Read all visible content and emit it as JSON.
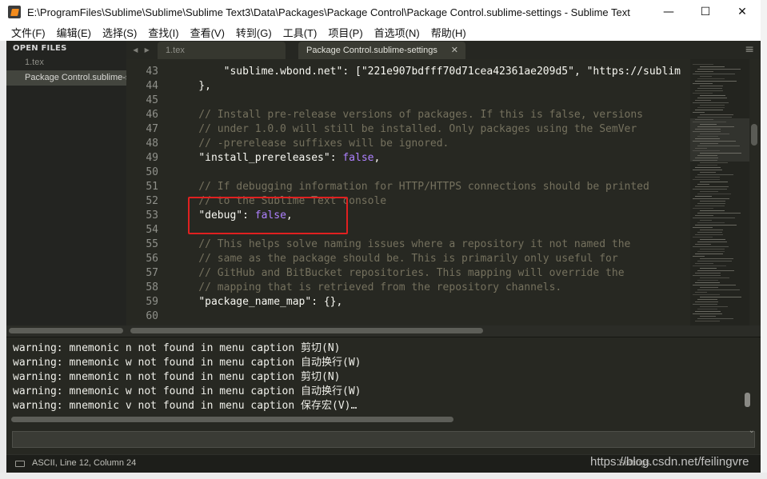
{
  "window": {
    "title": "E:\\ProgramFiles\\Sublime\\Sublime\\Sublime Text3\\Data\\Packages\\Package Control\\Package Control.sublime-settings - Sublime Text",
    "minimize_glyph": "—",
    "maximize_glyph": "☐",
    "close_glyph": "✕"
  },
  "menu": [
    {
      "label": "文件(F)"
    },
    {
      "label": "编辑(E)"
    },
    {
      "label": "选择(S)"
    },
    {
      "label": "查找(I)"
    },
    {
      "label": "查看(V)"
    },
    {
      "label": "转到(G)"
    },
    {
      "label": "工具(T)"
    },
    {
      "label": "项目(P)"
    },
    {
      "label": "首选项(N)"
    },
    {
      "label": "帮助(H)"
    }
  ],
  "sidebar": {
    "header": "OPEN FILES",
    "files": [
      {
        "label": "1.tex",
        "active": false
      },
      {
        "label": "Package Control.sublime-settings",
        "active": true
      }
    ]
  },
  "tabs": {
    "nav_left": "◀",
    "nav_right": "▶",
    "items": [
      {
        "label": "1.tex",
        "active": false
      },
      {
        "label": "Package Control.sublime-settings",
        "active": true,
        "close": "✕"
      }
    ],
    "menu_icon": "≡"
  },
  "editor": {
    "lines": [
      {
        "num": "43",
        "segments": [
          {
            "t": "        ",
            "c": "p"
          },
          {
            "t": "\"sublime.wbond.net\"",
            "c": "p"
          },
          {
            "t": ": [",
            "c": "p"
          },
          {
            "t": "\"221e907bdfff70d71cea42361ae209d5\"",
            "c": "p"
          },
          {
            "t": ", ",
            "c": "p"
          },
          {
            "t": "\"https://sublim",
            "c": "p"
          }
        ]
      },
      {
        "num": "44",
        "segments": [
          {
            "t": "    },",
            "c": "p"
          }
        ]
      },
      {
        "num": "45",
        "segments": []
      },
      {
        "num": "46",
        "segments": [
          {
            "t": "    // Install pre-release versions of packages. If this is false, versions",
            "c": "com"
          }
        ]
      },
      {
        "num": "47",
        "segments": [
          {
            "t": "    // under 1.0.0 will still be installed. Only packages using the SemVer",
            "c": "com"
          }
        ]
      },
      {
        "num": "48",
        "segments": [
          {
            "t": "    // -prerelease suffixes will be ignored.",
            "c": "com"
          }
        ]
      },
      {
        "num": "49",
        "segments": [
          {
            "t": "    ",
            "c": "p"
          },
          {
            "t": "\"install_prereleases\"",
            "c": "p"
          },
          {
            "t": ": ",
            "c": "p"
          },
          {
            "t": "false",
            "c": "kw"
          },
          {
            "t": ",",
            "c": "p"
          }
        ]
      },
      {
        "num": "50",
        "segments": []
      },
      {
        "num": "51",
        "segments": [
          {
            "t": "    // If debugging information for HTTP/HTTPS connections should be printed",
            "c": "com"
          }
        ]
      },
      {
        "num": "52",
        "segments": [
          {
            "t": "    // to the Sublime Text console",
            "c": "com"
          }
        ]
      },
      {
        "num": "53",
        "segments": [
          {
            "t": "    ",
            "c": "p"
          },
          {
            "t": "\"debug\"",
            "c": "p"
          },
          {
            "t": ": ",
            "c": "p"
          },
          {
            "t": "false",
            "c": "kw"
          },
          {
            "t": ",",
            "c": "p"
          }
        ]
      },
      {
        "num": "54",
        "segments": []
      },
      {
        "num": "55",
        "segments": [
          {
            "t": "    // This helps solve naming issues where a repository it not named the",
            "c": "com"
          }
        ]
      },
      {
        "num": "56",
        "segments": [
          {
            "t": "    // same as the package should be. This is primarily only useful for",
            "c": "com"
          }
        ]
      },
      {
        "num": "57",
        "segments": [
          {
            "t": "    // GitHub and BitBucket repositories. This mapping will override the",
            "c": "com"
          }
        ]
      },
      {
        "num": "58",
        "segments": [
          {
            "t": "    // mapping that is retrieved from the repository channels.",
            "c": "com"
          }
        ]
      },
      {
        "num": "59",
        "segments": [
          {
            "t": "    ",
            "c": "p"
          },
          {
            "t": "\"package_name_map\"",
            "c": "p"
          },
          {
            "t": ": {},",
            "c": "p"
          }
        ]
      },
      {
        "num": "60",
        "segments": []
      }
    ]
  },
  "console": {
    "lines": [
      "warning: mnemonic n not found in menu caption 剪切(N)",
      "warning: mnemonic w not found in menu caption 自动换行(W)",
      "warning: mnemonic n not found in menu caption 剪切(N)",
      "warning: mnemonic w not found in menu caption 自动换行(W)",
      "warning: mnemonic v not found in menu caption 保存宏(V)…"
    ],
    "input_value": "",
    "chevron": "⌄"
  },
  "status": {
    "text": "ASCII, Line 12, Column 24",
    "right": "Settings"
  },
  "watermark": "https://blog.csdn.net/feilingvre",
  "colors": {
    "background": "#272822",
    "comment": "#75715e",
    "keyword": "#ae81ff",
    "highlight_box": "#e02020"
  }
}
